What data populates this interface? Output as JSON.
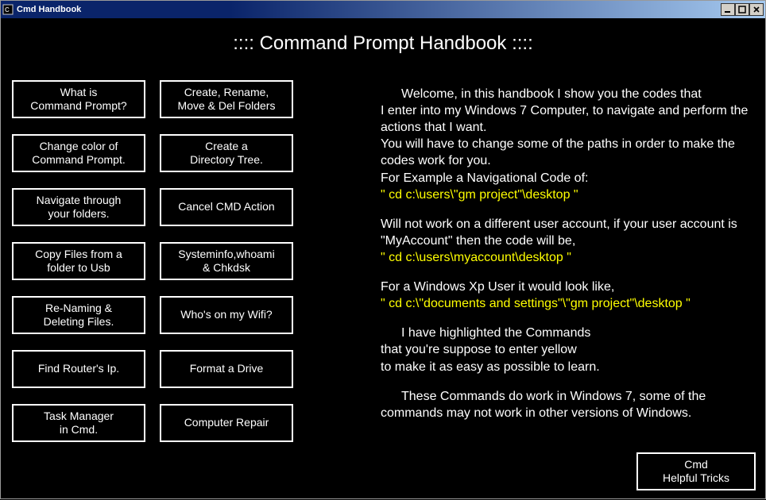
{
  "window": {
    "title": "Cmd Handbook"
  },
  "header": {
    "title": "::::  Command Prompt Handbook  ::::"
  },
  "buttons": {
    "b0": "What is\nCommand Prompt?",
    "b1": "Create, Rename,\nMove & Del Folders",
    "b2": "Change color of\nCommand Prompt.",
    "b3": "Create a\nDirectory Tree.",
    "b4": "Navigate through\nyour folders.",
    "b5": "Cancel CMD Action",
    "b6": "Copy Files from a\nfolder to Usb",
    "b7": "Systeminfo,whoami\n& Chkdsk",
    "b8": "Re-Naming &\nDeleting Files.",
    "b9": "Who's on my Wifi?",
    "b10": "Find Router's Ip.",
    "b11": "Format a Drive",
    "b12": "Task Manager\nin Cmd.",
    "b13": "Computer Repair"
  },
  "content": {
    "p1a": "Welcome, in this handbook I show you the codes that",
    "p1b": "I enter into my Windows 7 Computer, to navigate and perform the actions that I want.",
    "p2": "You will have to change some of the paths in order to make the codes work for you.",
    "p3": "For Example a Navigational Code of:",
    "code1": "\" cd c:\\users\\\"gm project\"\\desktop \"",
    "p4": "Will not work on a different user account, if your user account is \"MyAccount\" then the code will be,",
    "code2": "\" cd c:\\users\\myaccount\\desktop \"",
    "p5": "For a Windows Xp User it would look like,",
    "code3": "\" cd c:\\\"documents and settings\"\\\"gm project\"\\desktop \"",
    "p6a": "I have highlighted the Commands",
    "p6b": "that you're suppose to enter yellow",
    "p6c": "to make it as easy as possible to learn.",
    "p7": "These Commands do work in Windows 7, some of the commands may not work in other versions of Windows."
  },
  "footer": {
    "tricks": "Cmd\nHelpful Tricks"
  }
}
